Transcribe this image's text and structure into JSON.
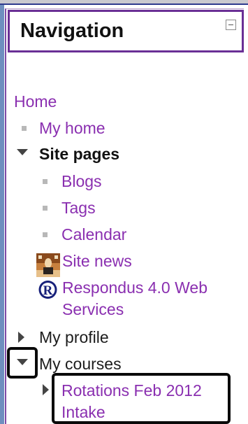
{
  "block": {
    "title": "Navigation"
  },
  "nav": {
    "home": "Home",
    "my_home": "My home",
    "site_pages": "Site pages",
    "blogs": "Blogs",
    "tags": "Tags",
    "calendar": "Calendar",
    "site_news": "Site news",
    "respondus_line1": "Respondus 4.0 Web",
    "respondus_line2": "Services",
    "my_profile": "My profile",
    "my_courses": "My courses",
    "course_line1": "Rotations Feb 2012",
    "course_line2": "Intake"
  },
  "icons": {
    "collapse": "collapse-icon",
    "site_news": "news-icon",
    "respondus": "respondus-r-icon"
  },
  "colors": {
    "link": "#8a2fb0",
    "header_border": "#6a2f95",
    "highlight": "#0a0a0a"
  }
}
